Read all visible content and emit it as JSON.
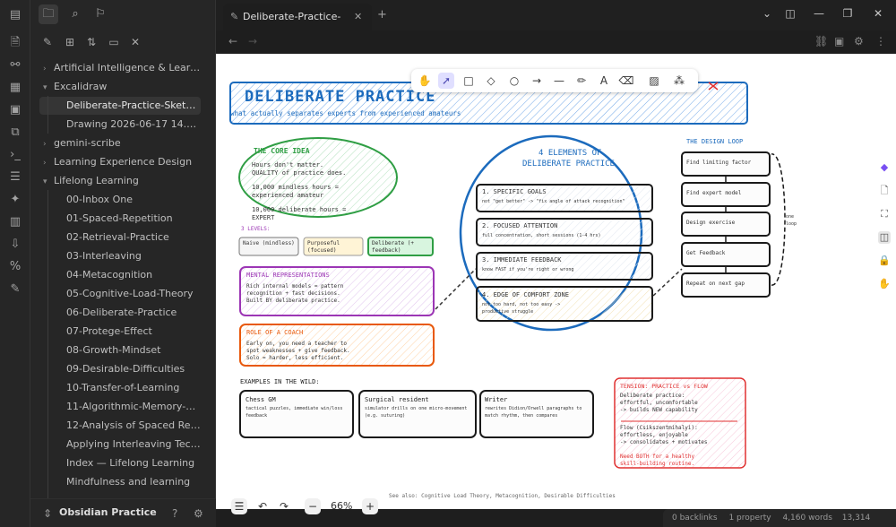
{
  "sidebar": {
    "tree": [
      {
        "label": "Artificial Intelligence & Learning",
        "type": "folder",
        "open": false
      },
      {
        "label": "Excalidraw",
        "type": "folder",
        "open": true
      },
      {
        "label": "Deliberate-Practice-Sketchno...",
        "type": "file",
        "selected": true
      },
      {
        "label": "Drawing 2026-06-17 14.01.5...",
        "type": "file"
      },
      {
        "label": "gemini-scribe",
        "type": "folder",
        "open": false
      },
      {
        "label": "Learning Experience Design",
        "type": "folder",
        "open": false
      },
      {
        "label": "Lifelong Learning",
        "type": "folder",
        "open": true
      },
      {
        "label": "00-Inbox One",
        "type": "file"
      },
      {
        "label": "01-Spaced-Repetition",
        "type": "file"
      },
      {
        "label": "02-Retrieval-Practice",
        "type": "file"
      },
      {
        "label": "03-Interleaving",
        "type": "file"
      },
      {
        "label": "04-Metacognition",
        "type": "file"
      },
      {
        "label": "05-Cognitive-Load-Theory",
        "type": "file"
      },
      {
        "label": "06-Deliberate-Practice",
        "type": "file"
      },
      {
        "label": "07-Protege-Effect",
        "type": "file"
      },
      {
        "label": "08-Growth-Mindset",
        "type": "file"
      },
      {
        "label": "09-Desirable-Difficulties",
        "type": "file"
      },
      {
        "label": "10-Transfer-of-Learning",
        "type": "file"
      },
      {
        "label": "11-Algorithmic-Memory-Mo...",
        "type": "file"
      },
      {
        "label": "12-Analysis of Spaced Repeti...",
        "type": "file"
      },
      {
        "label": "Applying Interleaving Techni...",
        "type": "file"
      },
      {
        "label": "Index — Lifelong Learning",
        "type": "file"
      },
      {
        "label": "Mindfulness and learning",
        "type": "file"
      }
    ],
    "vault_name": "Obsidian Practice"
  },
  "tab": {
    "title": "Deliberate-Practice-Sk..."
  },
  "canvas": {
    "zoom": "66%",
    "title": "DELIBERATE PRACTICE",
    "subtitle": "what actually separates experts from experienced amateurs",
    "core_idea": {
      "heading": "THE CORE IDEA",
      "lines": [
        "Hours don't matter.",
        "QUALITY of practice does.",
        "10,000 mindless hours =",
        "experienced amateur",
        "10,000 deliberate hours =",
        "EXPERT"
      ]
    },
    "levels_label": "3 LEVELS:",
    "levels": [
      "Naive (mindless)",
      "Purposeful (focused)",
      "Deliberate (+ feedback)"
    ],
    "mental": {
      "heading": "MENTAL REPRESENTATIONS",
      "lines": [
        "Rich internal models = pattern",
        "recognition + fast decisions.",
        "Built BY deliberate practice."
      ]
    },
    "coach": {
      "heading": "ROLE OF A COACH",
      "lines": [
        "Early on, you need a teacher to",
        "spot weaknesses + give feedback.",
        "Solo = harder, less efficient."
      ]
    },
    "elements": {
      "heading_1": "4 ELEMENTS OF",
      "heading_2": "DELIBERATE PRACTICE",
      "items": [
        {
          "title": "1. SPECIFIC GOALS",
          "sub": "not \"get better\" -> \"fix angle of attack recognition\""
        },
        {
          "title": "2. FOCUSED ATTENTION",
          "sub": "full concentration, short sessions (1-4 hrs)"
        },
        {
          "title": "3. IMMEDIATE FEEDBACK",
          "sub": "know FAST if you're right or wrong"
        },
        {
          "title": "4. EDGE OF COMFORT ZONE",
          "sub": "not too hard, not too easy -> productive struggle"
        }
      ]
    },
    "loop": {
      "heading": "THE DESIGN LOOP",
      "steps": [
        "Find limiting factor",
        "Find expert model",
        "Design exercise",
        "Get Feedback",
        "Repeat on next gap"
      ],
      "side_label": "one loop"
    },
    "examples": {
      "heading": "EXAMPLES IN THE WILD:",
      "items": [
        {
          "title": "Chess GM",
          "body": "tactical puzzles, immediate win/loss feedback"
        },
        {
          "title": "Surgical resident",
          "body": "simulator drills on one micro-movement (e.g. suturing)"
        },
        {
          "title": "Writer",
          "body": "rewrites Didion/Orwell paragraphs to match rhythm, then compares"
        }
      ]
    },
    "tension": {
      "heading": "TENSION: PRACTICE vs FLOW",
      "lines_a": [
        "Deliberate practice:",
        "effortful, uncomfortable",
        "-> builds NEW capability"
      ],
      "lines_b": [
        "Flow (Csikszentmihalyi):",
        "effortless, enjoyable",
        "-> consolidates + motivates"
      ],
      "footer": [
        "Need BOTH for a healthy",
        "skill-building routine."
      ]
    },
    "see_also": "See also: Cognitive Load Theory, Metacognition, Desirable Difficulties"
  },
  "status": {
    "backlinks": "0 backlinks",
    "properties": "1 property",
    "words": "4,160 words",
    "chars": "13,314 characters"
  },
  "colors": {
    "title_blue": "#1c6bbd",
    "green": "#2f9e44",
    "purple": "#9c36b5",
    "orange": "#e8590c",
    "red": "#e03131",
    "pink": "#f4c2d7"
  }
}
